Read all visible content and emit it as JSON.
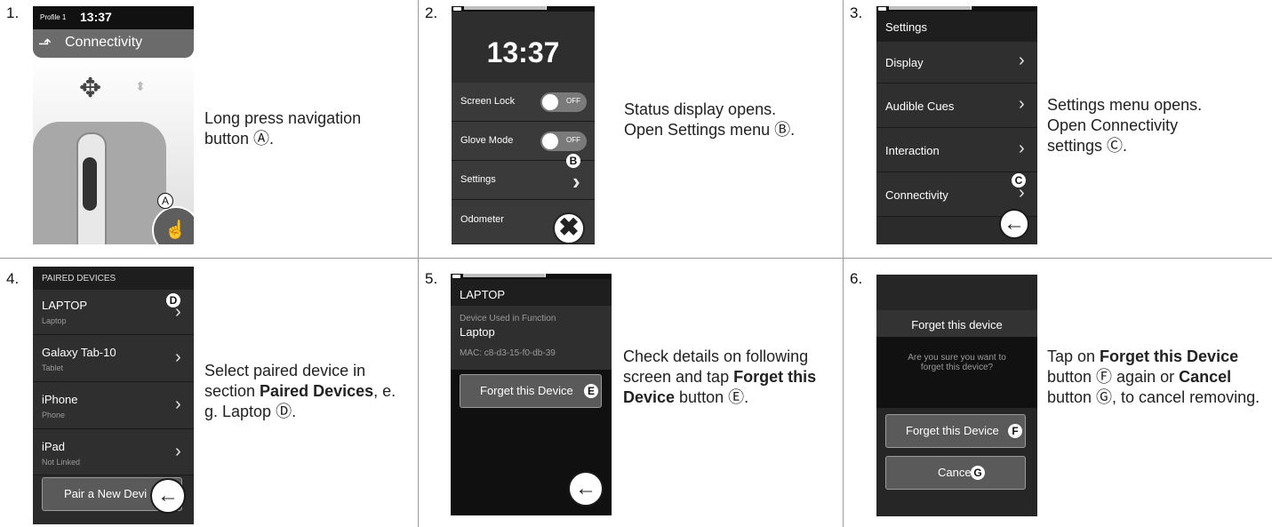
{
  "steps": [
    {
      "number": "1.",
      "caption_text": "Long press navigation button Ⓐ."
    },
    {
      "number": "2.",
      "caption_line1": "Status display opens.",
      "caption_line2": "Open Settings menu Ⓑ."
    },
    {
      "number": "3.",
      "caption_line1": "Settings menu opens.",
      "caption_line2": "Open Connectivity",
      "caption_line3": "settings Ⓒ."
    },
    {
      "number": "4.",
      "caption_pre": "Select paired device in section ",
      "caption_bold": "Paired Devices",
      "caption_post": ", e. g. Laptop Ⓓ."
    },
    {
      "number": "5.",
      "caption_pre": "Check details on following screen and tap ",
      "caption_bold": "Forget this Device",
      "caption_post": " button Ⓔ."
    },
    {
      "number": "6.",
      "caption_pre": "Tap on ",
      "caption_bold1": "Forget this Device",
      "caption_mid": " button Ⓕ again or ",
      "caption_bold2": "Cancel",
      "caption_post": " button Ⓖ, to cancel removing."
    }
  ],
  "screen1": {
    "profile": "Profile 1",
    "time": "13:37",
    "title": "Connectivity",
    "callout": "A"
  },
  "screen2": {
    "time": "13:37",
    "rows": [
      {
        "label": "Screen Lock",
        "toggle": "OFF"
      },
      {
        "label": "Glove Mode",
        "toggle": "OFF"
      },
      {
        "label": "Settings"
      },
      {
        "label": "Odometer"
      }
    ],
    "callout": "B"
  },
  "screen3": {
    "title": "Settings",
    "items": [
      "Display",
      "Audible Cues",
      "Interaction",
      "Connectivity"
    ],
    "callout": "C"
  },
  "screen4": {
    "header": "PAIRED DEVICES",
    "devices": [
      {
        "name": "LAPTOP",
        "type": "Laptop"
      },
      {
        "name": "Galaxy Tab-10",
        "type": "Tablet"
      },
      {
        "name": "iPhone",
        "type": "Phone"
      },
      {
        "name": "iPad",
        "type": "Not Linked"
      }
    ],
    "pair_button": "Pair a New Devi",
    "callout": "D"
  },
  "screen5": {
    "title": "LAPTOP",
    "function_label": "Device Used in Function",
    "function_value": "Laptop",
    "mac": "MAC: c8-d3-15-f0-db-39",
    "forget_button": "Forget this Device",
    "callout": "E"
  },
  "screen6": {
    "dialog_title": "Forget this device",
    "dialog_message": "Are you sure you want to forget this device?",
    "forget_button": "Forget this Device",
    "forget_callout": "F",
    "cancel_button": "Cancel",
    "cancel_callout": "G"
  }
}
